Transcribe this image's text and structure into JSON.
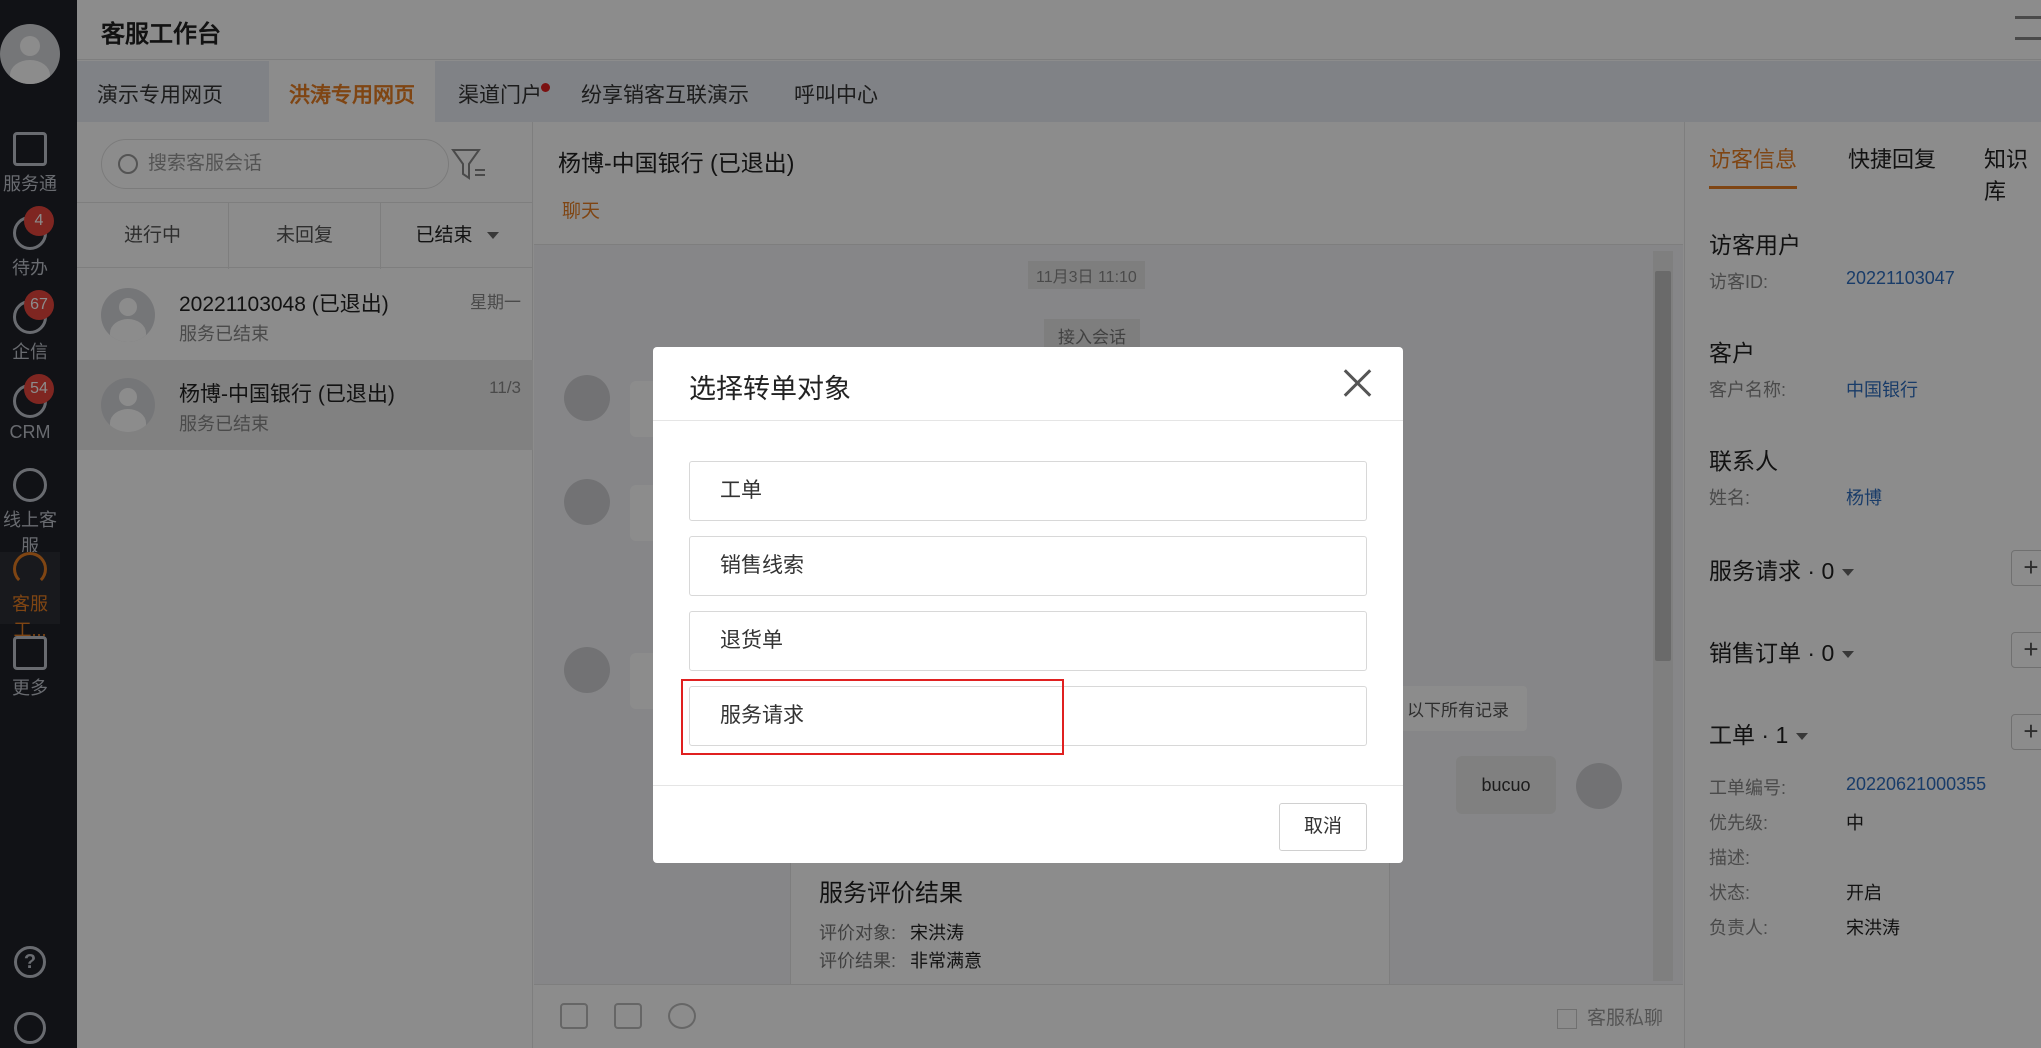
{
  "header": {
    "title": "客服工作台"
  },
  "rail": {
    "items": [
      {
        "label": "服务通"
      },
      {
        "label": "待办",
        "badge": "4"
      },
      {
        "label": "企信",
        "badge": "67"
      },
      {
        "label": "CRM",
        "badge": "54"
      },
      {
        "label": "线上客服"
      },
      {
        "label": "客服工..."
      },
      {
        "label": "更多"
      }
    ],
    "help": "?"
  },
  "tabs": [
    "演示专用网页",
    "洪涛专用网页",
    "渠道门户",
    "纷享销客互联演示",
    "呼叫中心"
  ],
  "session_list": {
    "search_placeholder": "搜索客服会话",
    "status_tabs": [
      "进行中",
      "未回复",
      "已结束"
    ],
    "sessions": [
      {
        "name": "20221103048 (已退出)",
        "sub": "服务已结束",
        "time": "星期一"
      },
      {
        "name": "杨博-中国银行 (已退出)",
        "sub": "服务已结束",
        "time": "11/3"
      }
    ]
  },
  "chat": {
    "title": "杨博-中国银行 (已退出)",
    "tab": "聊天",
    "timestamp": "11月3日 11:10",
    "system_msg": "接入会话",
    "history_link": "以下所有记录",
    "my_msg": "bucuo",
    "eval": {
      "title": "服务评价结果",
      "target_label": "评价对象:",
      "target_value": "宋洪涛",
      "result_label": "评价结果:",
      "result_value": "非常满意"
    },
    "private_label": "客服私聊"
  },
  "right_panel": {
    "tabs": [
      "访客信息",
      "快捷回复",
      "知识库"
    ],
    "visitor": {
      "section": "访客用户",
      "id_label": "访客ID:",
      "id_value": "20221103047"
    },
    "customer": {
      "section": "客户",
      "name_label": "客户名称:",
      "name_value": "中国银行"
    },
    "contact": {
      "section": "联系人",
      "name_label": "姓名:",
      "name_value": "杨博"
    },
    "service_request": "服务请求 · 0",
    "sales_order": "销售订单 · 0",
    "work_order": {
      "section": "工单 · 1",
      "fields": [
        {
          "label": "工单编号:",
          "value": "20220621000355"
        },
        {
          "label": "优先级:",
          "value": "中"
        },
        {
          "label": "描述:",
          "value": ""
        },
        {
          "label": "状态:",
          "value": "开启"
        },
        {
          "label": "负责人:",
          "value": "宋洪涛"
        }
      ]
    },
    "plus": "+"
  },
  "modal": {
    "title": "选择转单对象",
    "options": [
      "工单",
      "销售线索",
      "退货单",
      "服务请求"
    ],
    "cancel": "取消"
  },
  "colors": {
    "accent": "#e87f23",
    "link": "#2f6ebf",
    "highlight": "#e02020",
    "badge": "#e8453c"
  }
}
